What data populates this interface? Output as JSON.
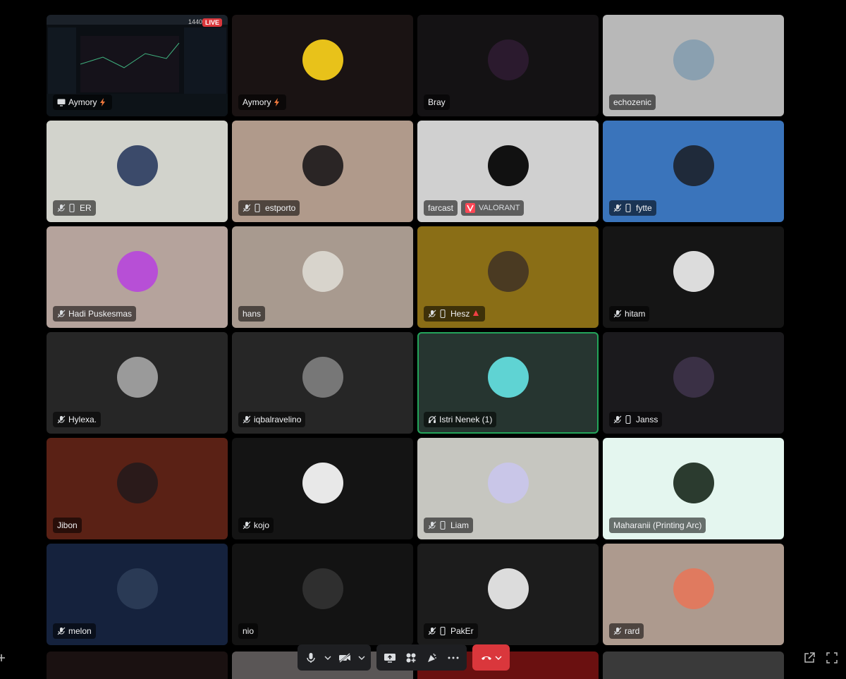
{
  "stream_overlay": {
    "viewer_count": "1440",
    "live_label": "LIVE"
  },
  "tiles": [
    {
      "name": "Aymory",
      "bg": "#0b0f14",
      "screenshare": true,
      "boost": true
    },
    {
      "name": "Aymory",
      "bg": "#1a1313",
      "boost": true,
      "avatar": "#e8c21a"
    },
    {
      "name": "Bray",
      "bg": "#141214",
      "avatar": "#2b1a2e"
    },
    {
      "name": "echozenic",
      "bg": "#b8b8b8",
      "avatar": "#8aa0b0"
    },
    {
      "name": "ER",
      "bg": "#d2d3cc",
      "muted": true,
      "mobile": true,
      "avatar": "#3b4a6a"
    },
    {
      "name": "estporto",
      "bg": "#b09a8b",
      "muted": true,
      "mobile": true,
      "avatar": "#2a2525"
    },
    {
      "name": "farcast",
      "bg": "#d0d0d0",
      "avatar": "#111",
      "activity": "VALORANT"
    },
    {
      "name": "fytte",
      "bg": "#3a74bb",
      "muted": true,
      "mobile": true,
      "avatar": "#1f2a3a"
    },
    {
      "name": "Hadi Puskesmas",
      "bg": "#b5a39c",
      "muted": true,
      "avatar": "#b74fd6"
    },
    {
      "name": "hans",
      "bg": "#a89a8f",
      "avatar": "#d8d4cc"
    },
    {
      "name": "Hesz",
      "bg": "#8a6e16",
      "muted": true,
      "mobile": true,
      "warning": true,
      "avatar": "#4a3a22"
    },
    {
      "name": "hitam",
      "bg": "#151515",
      "muted": true,
      "avatar": "#dcdcdc"
    },
    {
      "name": "Hylexa.",
      "bg": "#262626",
      "muted": true,
      "avatar": "#9a9a9a"
    },
    {
      "name": "iqbalravelino",
      "bg": "#262626",
      "muted": true,
      "avatar": "#777"
    },
    {
      "name": "Istri Nenek (1)",
      "bg": "#263530",
      "speaking": true,
      "deafened": true,
      "avatar": "#5fd3d3"
    },
    {
      "name": "Janss",
      "bg": "#1b1a1d",
      "muted": true,
      "mobile": true,
      "avatar": "#3a3045"
    },
    {
      "name": "Jibon",
      "bg": "#5a2115",
      "avatar": "#2a1a1a"
    },
    {
      "name": "kojo",
      "bg": "#141414",
      "muted": true,
      "avatar": "#e8e8e8"
    },
    {
      "name": "Liam",
      "bg": "#c6c6c0",
      "muted": true,
      "mobile": true,
      "avatar": "#c9c6e8"
    },
    {
      "name": "Maharanii (Printing Arc)",
      "bg": "#e4f6ef",
      "avatar": "#2b3b2f"
    },
    {
      "name": "melon",
      "bg": "#15223d",
      "muted": true,
      "avatar": "#2a3a55"
    },
    {
      "name": "nio",
      "bg": "#131313",
      "avatar": "#2f2f2f"
    },
    {
      "name": "PakEr",
      "bg": "#1c1c1c",
      "muted": true,
      "mobile": true,
      "avatar": "#dcdcdc"
    },
    {
      "name": "rard",
      "bg": "#ad9a8e",
      "muted": true,
      "avatar": "#e07a5f"
    }
  ],
  "bottom_row_colors": [
    "#1a1111",
    "#5a5656",
    "#6a1010",
    "#3a3a3a"
  ],
  "controls": {
    "mic": "mic-icon",
    "camera": "camera-off-icon",
    "screen_share": "screen-share-icon",
    "activities": "activities-icon",
    "soundboard": "soundboard-icon",
    "more": "more-icon",
    "disconnect": "disconnect-icon"
  },
  "colors": {
    "speaking": "#23a55a",
    "danger": "#da373c",
    "valorant": "#ff4655"
  }
}
